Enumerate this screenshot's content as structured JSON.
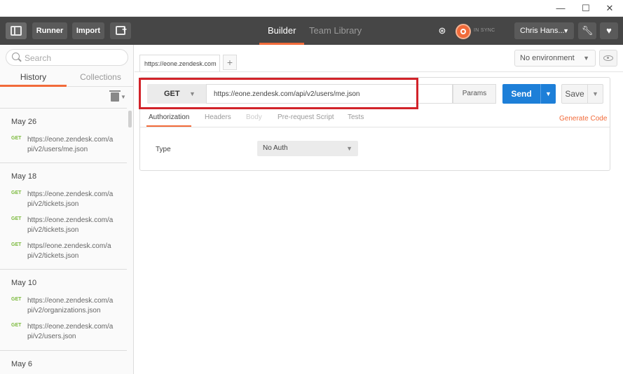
{
  "window": {
    "minimize": "—",
    "maximize": "☐",
    "close": "✕"
  },
  "toolbar": {
    "runner_label": "Runner",
    "import_label": "Import",
    "tabs": [
      {
        "label": "Builder",
        "active": true
      },
      {
        "label": "Team Library",
        "active": false
      }
    ],
    "sync_status": "IN SYNC",
    "user_name": "Chris Hans...",
    "icons": [
      "sidebar-toggle-icon",
      "new-window-icon",
      "interceptor-icon",
      "sync-icon",
      "wrench-icon",
      "heart-icon"
    ]
  },
  "sidebar": {
    "search_placeholder": "Search",
    "tabs": [
      {
        "label": "History",
        "active": true
      },
      {
        "label": "Collections",
        "active": false
      }
    ],
    "groups": [
      {
        "date": "May 26",
        "items": [
          {
            "method": "GET",
            "url": "https://eone.zendesk.com/api/v2/users/me.json"
          }
        ]
      },
      {
        "date": "May 18",
        "items": [
          {
            "method": "GET",
            "url": "https://eone.zendesk.com/api/v2/tickets.json"
          },
          {
            "method": "GET",
            "url": "https://eone.zendesk.com/api/v2/tickets.json"
          },
          {
            "method": "GET",
            "url": "https//eone.zendesk.com/api/v2/tickets.json"
          }
        ]
      },
      {
        "date": "May 10",
        "items": [
          {
            "method": "GET",
            "url": "https://eone.zendesk.com/api/v2/organizations.json"
          },
          {
            "method": "GET",
            "url": "https://eone.zendesk.com/api/v2/users.json"
          }
        ]
      },
      {
        "date": "May 6",
        "items": []
      }
    ]
  },
  "main": {
    "open_tab": "https://eone.zendesk.com",
    "add_tab": "+",
    "environment": "No environment",
    "request": {
      "method": "GET",
      "url": "https://eone.zendesk.com/api/v2/users/me.json",
      "params_label": "Params",
      "send_label": "Send",
      "save_label": "Save"
    },
    "request_tabs": [
      {
        "label": "Authorization",
        "state": "active"
      },
      {
        "label": "Headers",
        "state": "normal"
      },
      {
        "label": "Body",
        "state": "disabled"
      },
      {
        "label": "Pre-request Script",
        "state": "normal"
      },
      {
        "label": "Tests",
        "state": "normal"
      }
    ],
    "generate_code": "Generate Code",
    "auth": {
      "type_label": "Type",
      "type_value": "No Auth"
    }
  },
  "colors": {
    "accent": "#f26b3a",
    "send": "#1d7fd8",
    "toolbar": "#464646",
    "get_method": "#7ab93a",
    "highlight": "#d2232a"
  }
}
